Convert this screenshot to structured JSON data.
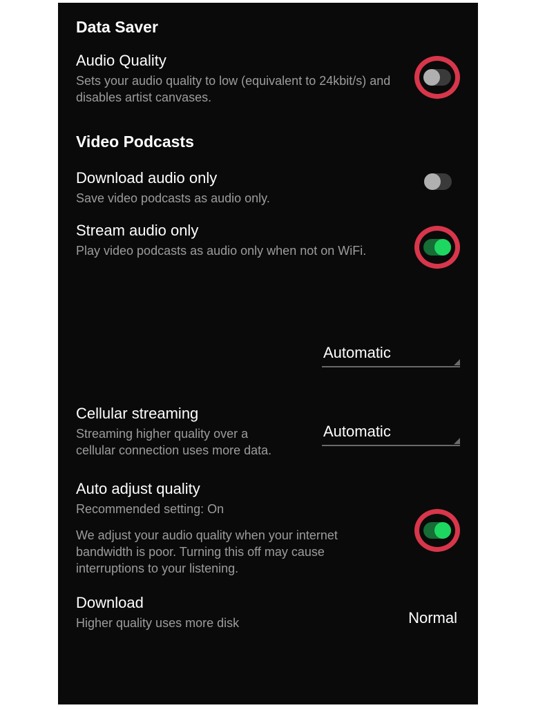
{
  "top": {
    "data_saver_header": "Data Saver",
    "audio_quality": {
      "title": "Audio Quality",
      "desc": "Sets your audio quality to low (equivalent to 24kbit/s) and disables artist canvases."
    },
    "video_podcasts_header": "Video Podcasts",
    "download_audio_only": {
      "title": "Download audio only",
      "desc": "Save video podcasts as audio only."
    },
    "stream_audio_only": {
      "title": "Stream audio only",
      "desc": "Play video podcasts as audio only when not on WiFi."
    }
  },
  "bottom": {
    "partial_top_value": "Automatic",
    "cellular_streaming": {
      "title": "Cellular streaming",
      "desc": "Streaming higher quality over a cellular connection uses more data.",
      "value": "Automatic"
    },
    "auto_adjust": {
      "title": "Auto adjust quality",
      "sub": "Recommended setting: On",
      "desc": "We adjust your audio quality when your internet bandwidth is poor. Turning this off may cause interruptions to your listening."
    },
    "download": {
      "title": "Download",
      "desc": "Higher quality uses more disk",
      "value": "Normal"
    }
  }
}
